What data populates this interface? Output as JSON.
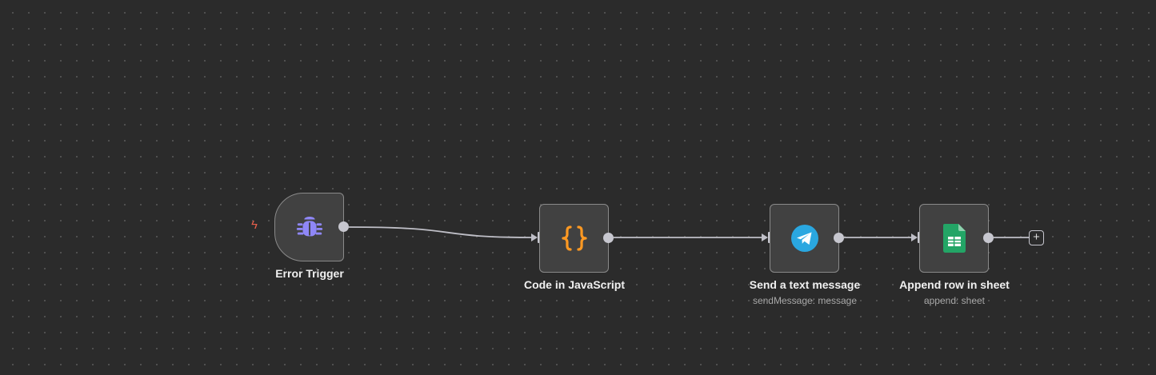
{
  "colors": {
    "canvas_bg": "#2b2b2b",
    "node_bg": "#414141",
    "node_border": "#8a8a8a",
    "wire": "#bfbfc7",
    "trigger_bolt": "#e8604c",
    "bug_icon": "#8f87f7",
    "code_icon": "#ff9922",
    "telegram_icon": "#2aa7e0",
    "sheets_icon": "#23a566"
  },
  "nodes": [
    {
      "id": "error-trigger",
      "label": "Error Trigger",
      "subtitle": "",
      "icon": "bug-icon"
    },
    {
      "id": "code-js",
      "label": "Code in JavaScript",
      "subtitle": "",
      "icon": "code-braces-icon"
    },
    {
      "id": "telegram",
      "label": "Send a text message",
      "subtitle": "sendMessage: message",
      "icon": "telegram-icon"
    },
    {
      "id": "sheets",
      "label": "Append row in sheet",
      "subtitle": "append: sheet",
      "icon": "google-sheets-icon"
    }
  ],
  "connections": [
    {
      "from": "error-trigger",
      "to": "code-js"
    },
    {
      "from": "code-js",
      "to": "telegram"
    },
    {
      "from": "telegram",
      "to": "sheets"
    }
  ],
  "trigger_indicator": {
    "icon": "lightning-bolt-icon",
    "glyph": "ϟ"
  },
  "add_node": {
    "icon": "plus-icon",
    "glyph": "+"
  }
}
